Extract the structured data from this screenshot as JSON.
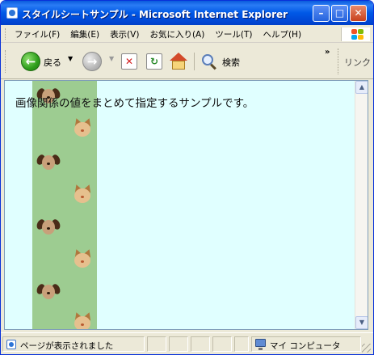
{
  "window": {
    "title": "スタイルシートサンプル - Microsoft Internet Explorer",
    "controls": {
      "minimize": "–",
      "maximize": "□",
      "close": "✕"
    }
  },
  "menubar": {
    "items": [
      "ファイル(F)",
      "編集(E)",
      "表示(V)",
      "お気に入り(A)",
      "ツール(T)",
      "ヘルプ(H)"
    ]
  },
  "toolbar": {
    "back_label": "戻る",
    "search_label": "検索",
    "links_label": "リンク",
    "more": "»",
    "dropdown_glyph": "▼",
    "icons": [
      "back-icon",
      "forward-icon",
      "stop-icon",
      "refresh-icon",
      "home-icon",
      "search-icon"
    ]
  },
  "content": {
    "text": "画像関係の値をまとめて指定するサンプルです。",
    "background_color": "#e0ffff",
    "strip_color": "#9dcc91"
  },
  "scrollbar": {
    "up": "▲",
    "down": "▼"
  },
  "statusbar": {
    "text": "ページが表示されました",
    "zone": "マイ コンピュータ"
  }
}
